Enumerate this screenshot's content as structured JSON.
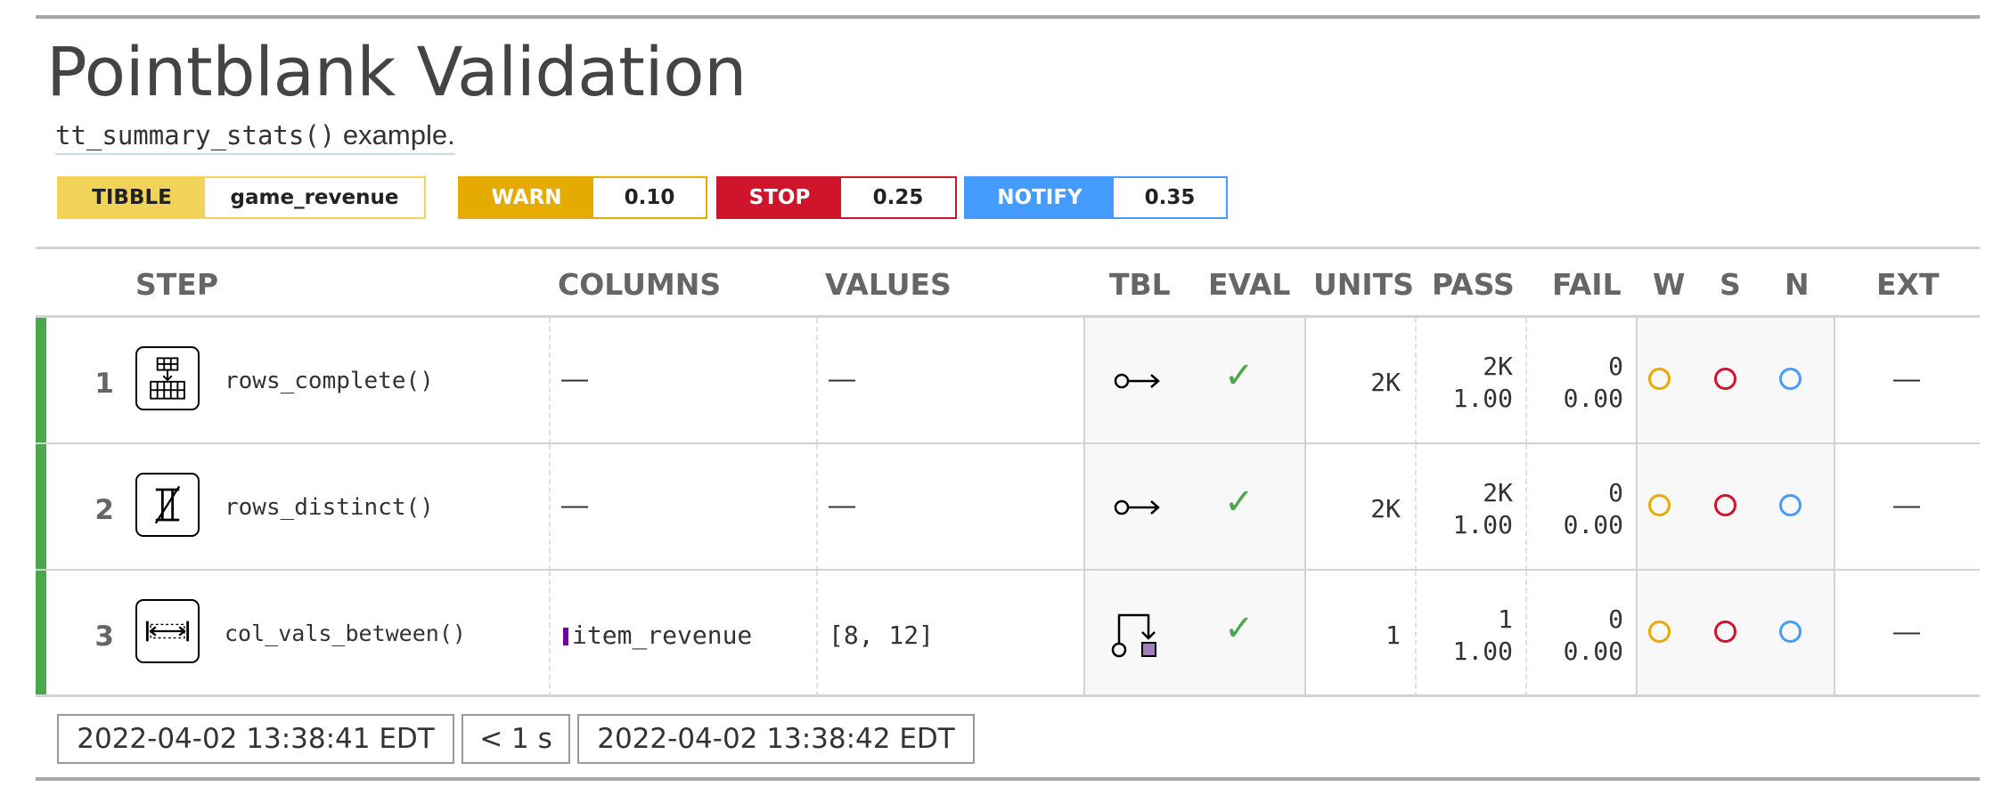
{
  "header": {
    "title": "Pointblank Validation",
    "subtitle_code": "tt_summary_stats()",
    "subtitle_text": " example."
  },
  "badges": {
    "table": {
      "label": "TIBBLE",
      "value": "game_revenue"
    },
    "warn": {
      "label": "WARN",
      "value": "0.10"
    },
    "stop": {
      "label": "STOP",
      "value": "0.25"
    },
    "notify": {
      "label": "NOTIFY",
      "value": "0.35"
    }
  },
  "columns": {
    "step": "STEP",
    "columns": "COLUMNS",
    "values": "VALUES",
    "tbl": "TBL",
    "eval": "EVAL",
    "units": "UNITS",
    "pass": "PASS",
    "fail": "FAIL",
    "w": "W",
    "s": "S",
    "n": "N",
    "ext": "EXT"
  },
  "rows": [
    {
      "step": "1",
      "fn": "rows_complete()",
      "icon": "rows-complete-icon",
      "columns": "—",
      "values": "—",
      "tbl": "no-precondition-icon",
      "eval": "✓",
      "units": "2K",
      "pass_n": "2K",
      "pass_f": "1.00",
      "fail_n": "0",
      "fail_f": "0.00",
      "ext": "—"
    },
    {
      "step": "2",
      "fn": "rows_distinct()",
      "icon": "rows-distinct-icon",
      "columns": "—",
      "values": "—",
      "tbl": "no-precondition-icon",
      "eval": "✓",
      "units": "2K",
      "pass_n": "2K",
      "pass_f": "1.00",
      "fail_n": "0",
      "fail_f": "0.00",
      "ext": "—"
    },
    {
      "step": "3",
      "fn": "col_vals_between()",
      "icon": "col-vals-between-icon",
      "columns": "item_revenue",
      "values": "[8, 12]",
      "tbl": "precondition-icon",
      "eval": "✓",
      "units": "1",
      "pass_n": "1",
      "pass_f": "1.00",
      "fail_n": "0",
      "fail_f": "0.00",
      "ext": "—"
    }
  ],
  "colors": {
    "warn": "#E5AB00",
    "stop": "#CF142B",
    "notify": "#439CFE",
    "pass_bar": "#4CA64C",
    "tibble": "#F1D35A",
    "column_marker": "#6E00A0"
  },
  "footer": {
    "start_time": "2022-04-02 13:38:41 EDT",
    "duration": "< 1 s",
    "end_time": "2022-04-02 13:38:42 EDT"
  }
}
